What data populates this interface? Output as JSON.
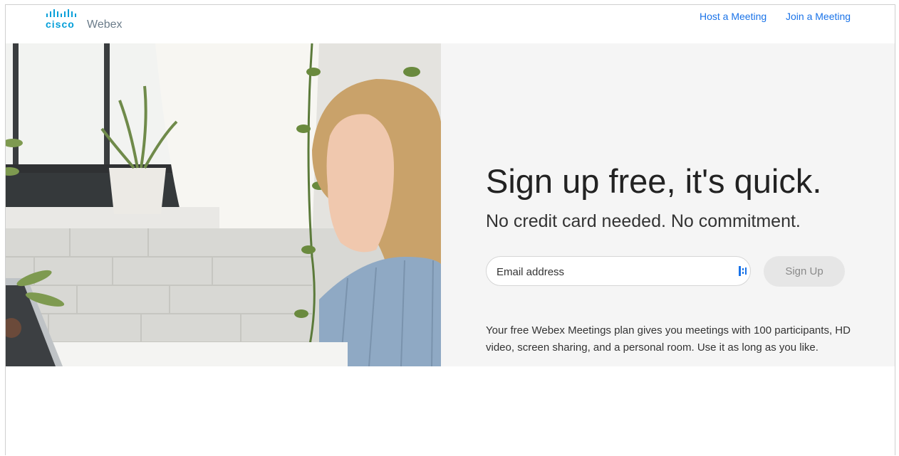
{
  "brand": {
    "cisco": "cisco",
    "product": "Webex",
    "color": "#049fd9"
  },
  "nav": {
    "host": "Host a Meeting",
    "join": "Join a Meeting"
  },
  "hero": {
    "headline": "Sign up free, it's quick.",
    "subhead": "No credit card needed. No commitment.",
    "email_placeholder": "Email address",
    "signup_label": "Sign Up",
    "description": "Your free Webex Meetings plan gives you meetings with 100 participants, HD video, screen sharing, and a personal room. Use it as long as you like."
  },
  "colors": {
    "link": "#1a73e8",
    "panel_bg": "#f5f5f5",
    "button_bg": "#e6e6e6"
  }
}
